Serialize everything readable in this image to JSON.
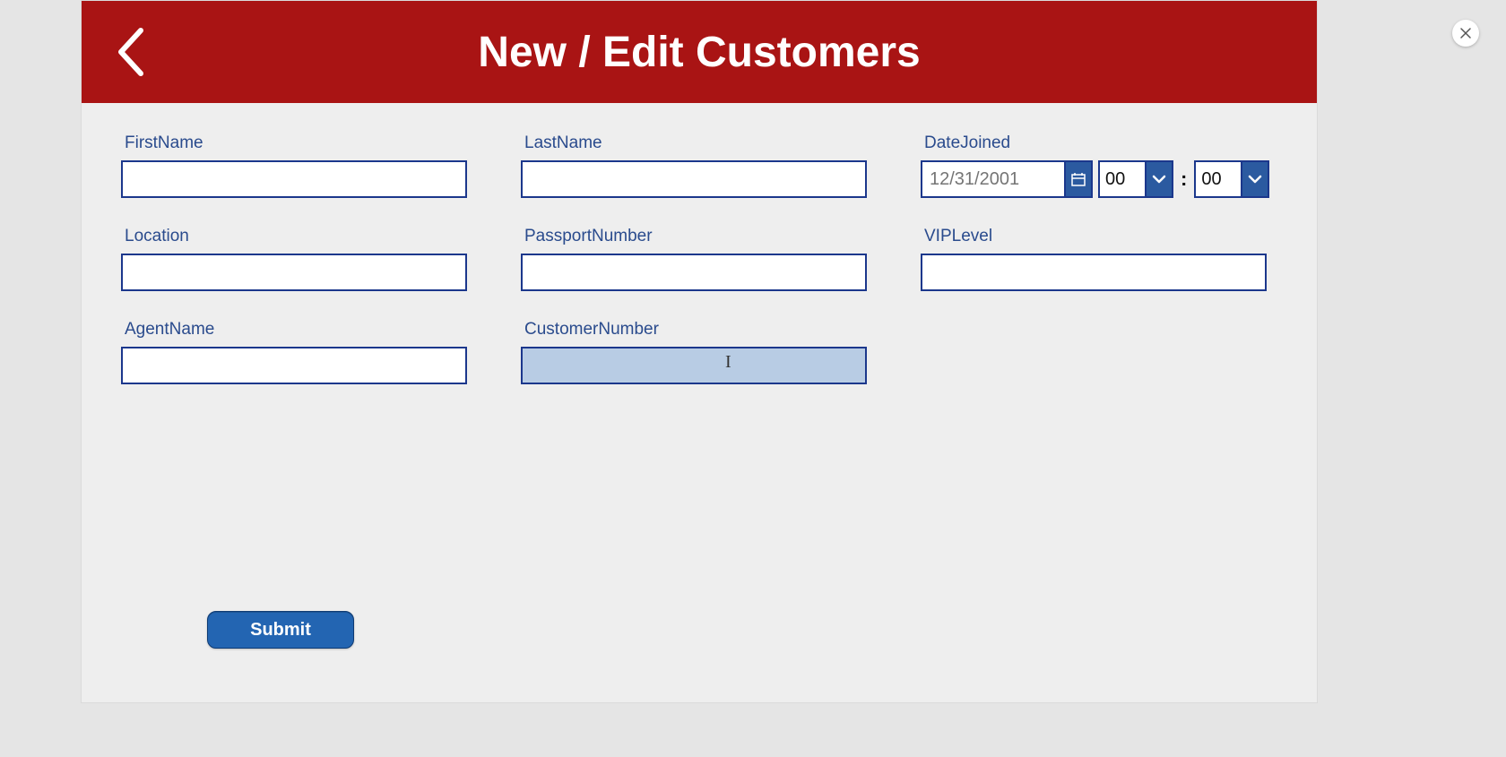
{
  "header": {
    "title": "New / Edit Customers"
  },
  "fields": {
    "first_name": {
      "label": "FirstName",
      "value": ""
    },
    "last_name": {
      "label": "LastName",
      "value": ""
    },
    "date_joined": {
      "label": "DateJoined",
      "date_placeholder": "12/31/2001",
      "hour": "00",
      "minute": "00",
      "separator": ":"
    },
    "location": {
      "label": "Location",
      "value": ""
    },
    "passport_number": {
      "label": "PassportNumber",
      "value": ""
    },
    "vip_level": {
      "label": "VIPLevel",
      "value": ""
    },
    "agent_name": {
      "label": "AgentName",
      "value": ""
    },
    "customer_number": {
      "label": "CustomerNumber",
      "value": ""
    }
  },
  "actions": {
    "submit_label": "Submit"
  }
}
